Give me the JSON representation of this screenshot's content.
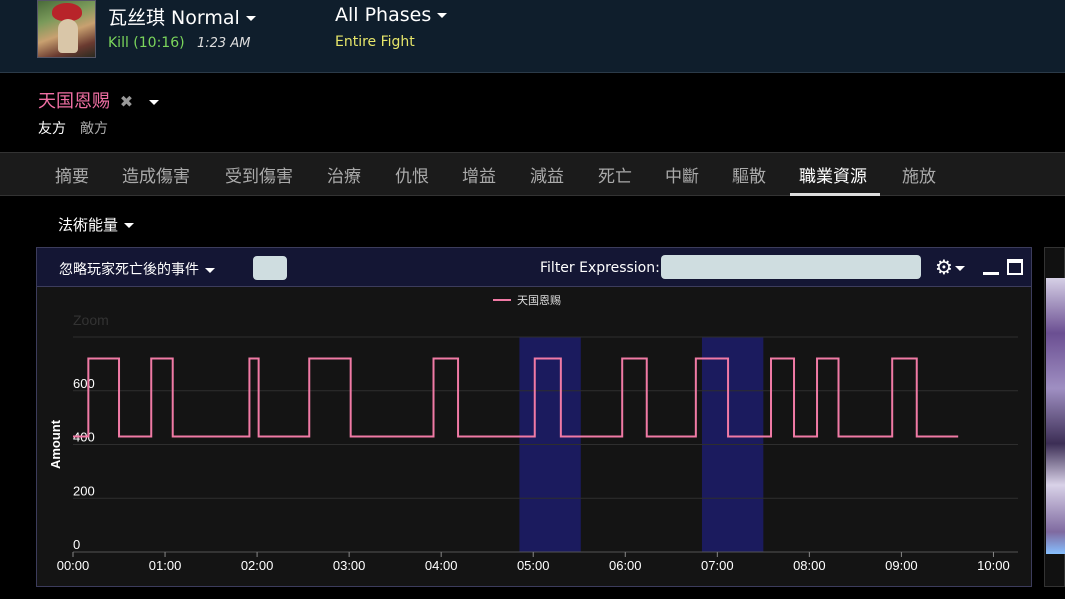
{
  "header": {
    "boss_name": "瓦丝琪 Normal",
    "kill_text": "Kill (10:16)",
    "kill_time": "1:23 AM",
    "phases_label": "All Phases",
    "phase_sub": "Entire Fight"
  },
  "player": {
    "name": "天国恩赐",
    "remove_icon": "✖",
    "side_friendly": "友方",
    "side_enemy": "敵方"
  },
  "tabs": [
    {
      "label": "摘要"
    },
    {
      "label": "造成傷害"
    },
    {
      "label": "受到傷害"
    },
    {
      "label": "治療"
    },
    {
      "label": "仇恨"
    },
    {
      "label": "增益"
    },
    {
      "label": "減益"
    },
    {
      "label": "死亡"
    },
    {
      "label": "中斷"
    },
    {
      "label": "驅散"
    },
    {
      "label": "職業資源",
      "active": true
    },
    {
      "label": "施放"
    }
  ],
  "resource_select": "法術能量",
  "panel": {
    "ignore_death_label": "忽略玩家死亡後的事件",
    "filter_label": "Filter Expression:",
    "filter_value": "",
    "gear_icon": "⚙"
  },
  "colors": {
    "series": "#f07aa5",
    "highlight": "#1b1b5e",
    "header_bg": "#0f1e2c",
    "kill_green": "#7bd65c",
    "phase_yellow": "#e6e66a"
  },
  "chart_data": {
    "type": "line",
    "title": "",
    "zoom_label": "Zoom",
    "xlabel": "",
    "ylabel": "Amount",
    "xlim": [
      0,
      616
    ],
    "ylim": [
      0,
      800
    ],
    "x_ticks": [
      {
        "v": 0,
        "label": "00:00"
      },
      {
        "v": 60,
        "label": "01:00"
      },
      {
        "v": 120,
        "label": "02:00"
      },
      {
        "v": 180,
        "label": "03:00"
      },
      {
        "v": 240,
        "label": "04:00"
      },
      {
        "v": 300,
        "label": "05:00"
      },
      {
        "v": 360,
        "label": "06:00"
      },
      {
        "v": 420,
        "label": "07:00"
      },
      {
        "v": 480,
        "label": "08:00"
      },
      {
        "v": 540,
        "label": "09:00"
      },
      {
        "v": 600,
        "label": "10:00"
      }
    ],
    "y_ticks": [
      {
        "v": 0,
        "label": "0"
      },
      {
        "v": 200,
        "label": "200"
      },
      {
        "v": 400,
        "label": "400"
      },
      {
        "v": 600,
        "label": "600"
      }
    ],
    "legend": "top",
    "grid": true,
    "highlight_bands": [
      {
        "from": 291,
        "to": 331
      },
      {
        "from": 410,
        "to": 450
      }
    ],
    "series": [
      {
        "name": "天国恩赐",
        "step": true,
        "x": [
          -13,
          10,
          30,
          51,
          65,
          115,
          121,
          154,
          181,
          235,
          251,
          301,
          318,
          358,
          374,
          406,
          427,
          455,
          470,
          485,
          499,
          534,
          550,
          577
        ],
        "y": [
          430,
          720,
          430,
          720,
          430,
          720,
          430,
          720,
          430,
          720,
          430,
          720,
          430,
          720,
          430,
          720,
          430,
          720,
          430,
          720,
          430,
          720,
          430,
          430
        ]
      }
    ]
  }
}
